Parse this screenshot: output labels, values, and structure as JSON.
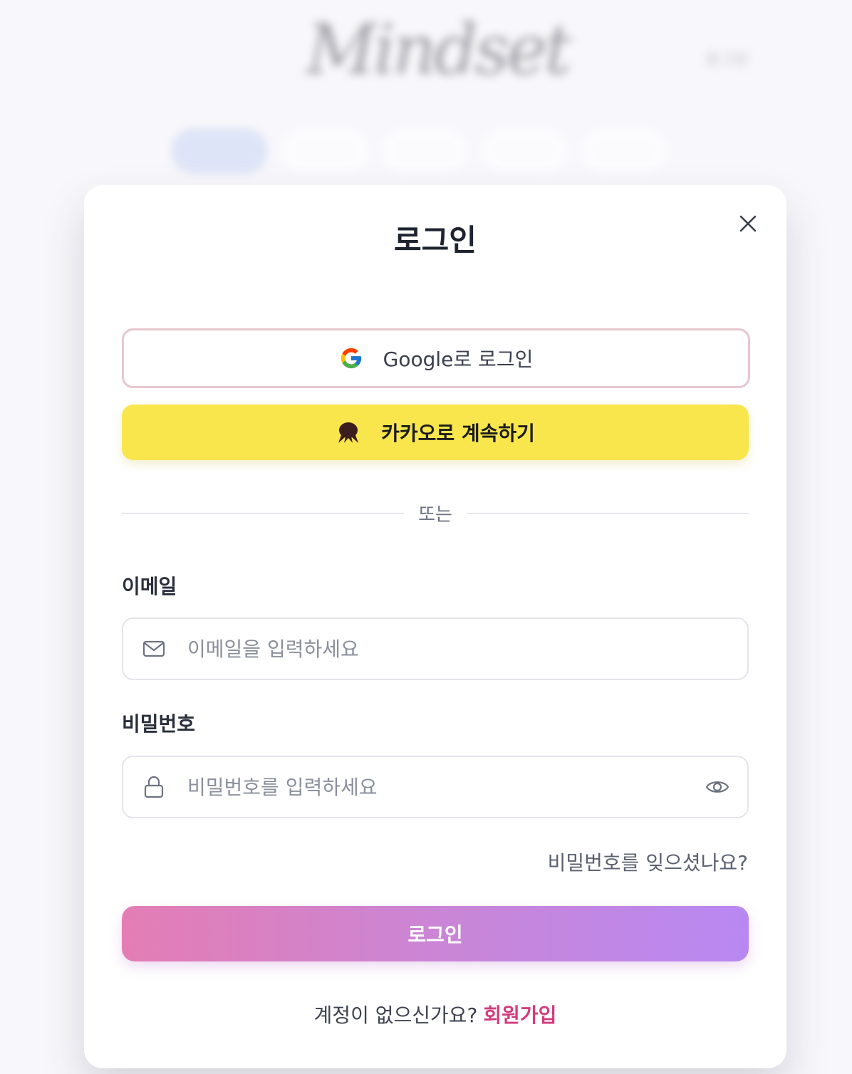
{
  "background": {
    "logo_text": "Mindset",
    "login_link": "로그인"
  },
  "modal": {
    "title": "로그인",
    "close_icon": "close-icon",
    "google_button": {
      "label": "Google로 로그인",
      "icon": "google-icon"
    },
    "kakao_button": {
      "label": "카카오로 계속하기",
      "icon": "kakao-icon"
    },
    "divider_text": "또는",
    "email": {
      "label": "이메일",
      "placeholder": "이메일을 입력하세요",
      "value": "",
      "icon": "mail-icon"
    },
    "password": {
      "label": "비밀번호",
      "placeholder": "비밀번호를 입력하세요",
      "value": "",
      "icon": "lock-icon",
      "toggle_icon": "eye-icon"
    },
    "forgot_password": "비밀번호를 잊으셨나요?",
    "submit_label": "로그인",
    "signup_prompt": "계정이 없으신가요?",
    "signup_link": "회원가입"
  },
  "colors": {
    "kakao_yellow": "#f9e64c",
    "accent_pink": "#d23c7e",
    "gradient_start": "#e47db4",
    "gradient_end": "#b888f2"
  }
}
